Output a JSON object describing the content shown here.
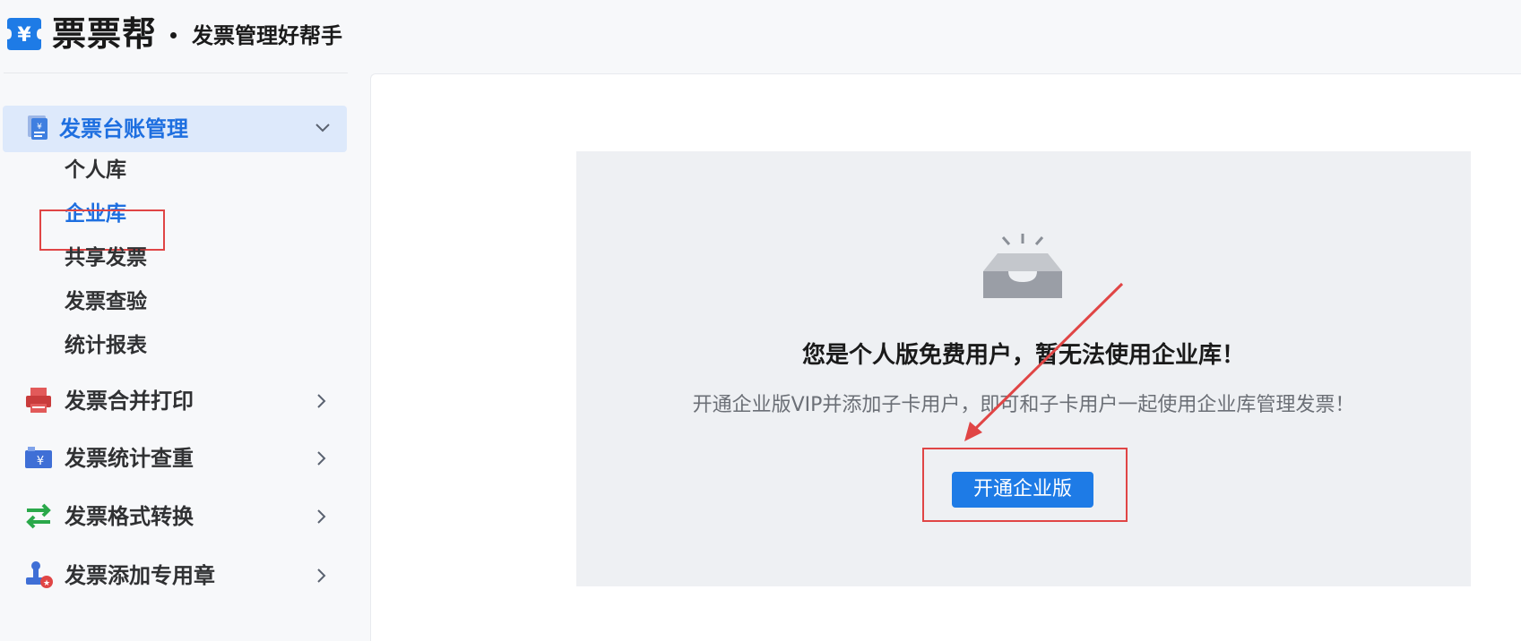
{
  "header": {
    "logo_text": "票票帮",
    "logo_symbol": "¥",
    "slogan": "发票管理好帮手"
  },
  "sidebar": {
    "groups": [
      {
        "label": "发票台账管理",
        "icon": "ledger-icon",
        "expanded": true,
        "items": [
          {
            "label": "个人库",
            "active": false
          },
          {
            "label": "企业库",
            "active": true
          },
          {
            "label": "共享发票",
            "active": false
          },
          {
            "label": "发票查验",
            "active": false
          },
          {
            "label": "统计报表",
            "active": false
          }
        ]
      },
      {
        "label": "发票合并打印",
        "icon": "printer-icon",
        "expanded": false
      },
      {
        "label": "发票统计查重",
        "icon": "invoice-stats-icon",
        "expanded": false
      },
      {
        "label": "发票格式转换",
        "icon": "convert-arrows-icon",
        "expanded": false
      },
      {
        "label": "发票添加专用章",
        "icon": "stamp-icon",
        "expanded": false
      }
    ]
  },
  "main": {
    "empty_state": {
      "icon": "empty-inbox-icon",
      "title": "您是个人版免费用户，暂无法使用企业库！",
      "description": "开通企业版VIP并添加子卡用户，即可和子卡用户一起使用企业库管理发票！",
      "button_label": "开通企业版"
    }
  },
  "colors": {
    "accent": "#1e7be6",
    "active_text": "#1e6fe0",
    "active_bg": "#dde9fb",
    "highlight": "#e04545",
    "panel_bg": "#eef0f3"
  }
}
